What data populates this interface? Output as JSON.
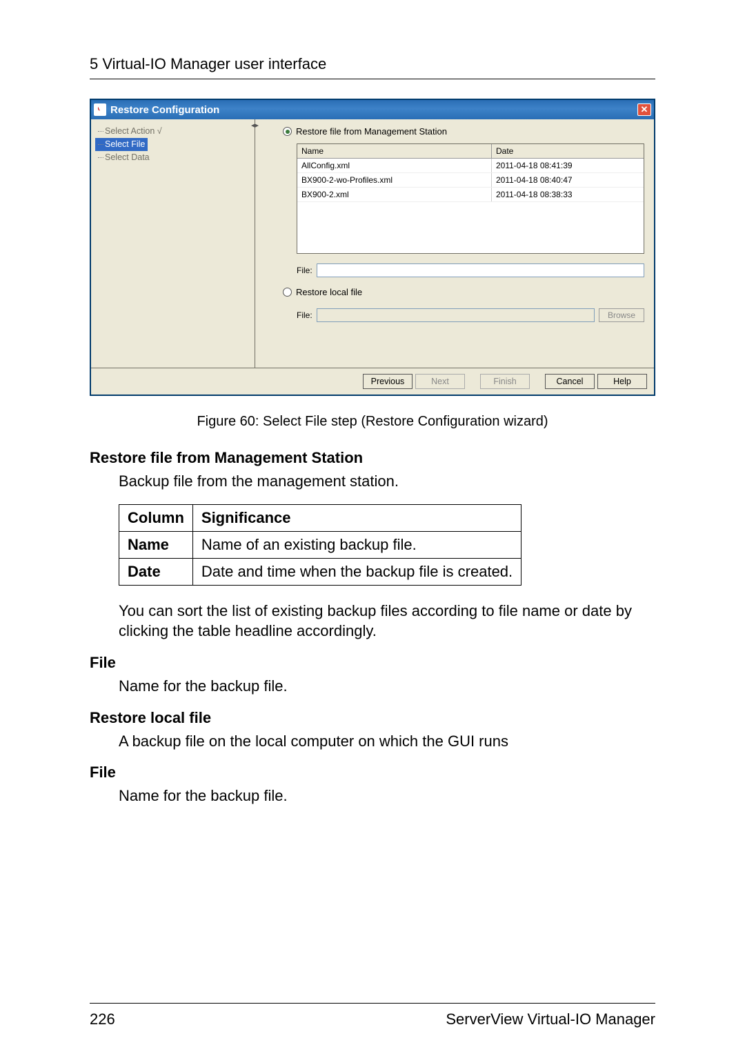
{
  "header": "5 Virtual-IO Manager user interface",
  "wizard": {
    "title": "Restore Configuration",
    "tree": {
      "item1": "Select Action",
      "item2": "Select File",
      "item3": "Select Data"
    },
    "radio1_label": "Restore file from Management Station",
    "radio2_label": "Restore local file",
    "table": {
      "col_name": "Name",
      "col_date": "Date",
      "rows": [
        {
          "name": "AllConfig.xml",
          "date": "2011-04-18 08:41:39"
        },
        {
          "name": "BX900-2-wo-Profiles.xml",
          "date": "2011-04-18 08:40:47"
        },
        {
          "name": "BX900-2.xml",
          "date": "2011-04-18 08:38:33"
        }
      ]
    },
    "file_label": "File:",
    "browse_label": "Browse",
    "buttons": {
      "previous": "Previous",
      "next": "Next",
      "finish": "Finish",
      "cancel": "Cancel",
      "help": "Help"
    }
  },
  "figure_caption": "Figure 60: Select File step (Restore Configuration wizard)",
  "doc": {
    "sect1_title": "Restore file from Management Station",
    "sect1_body": "Backup file from the management station.",
    "sig_table": {
      "h1": "Column",
      "h2": "Significance",
      "r1c1": "Name",
      "r1c2": "Name of an existing backup file.",
      "r2c1": "Date",
      "r2c2": "Date and time when the backup file is created."
    },
    "sort_note": "You can sort the list of existing backup files according to file name or date by clicking the table headline accordingly.",
    "file1_title": "File",
    "file1_body": "Name for the backup file.",
    "sect2_title": "Restore local file",
    "sect2_body": "A backup file on the local computer on which the GUI runs",
    "file2_title": "File",
    "file2_body": "Name for the backup file."
  },
  "footer": {
    "page": "226",
    "product": "ServerView Virtual-IO Manager"
  }
}
